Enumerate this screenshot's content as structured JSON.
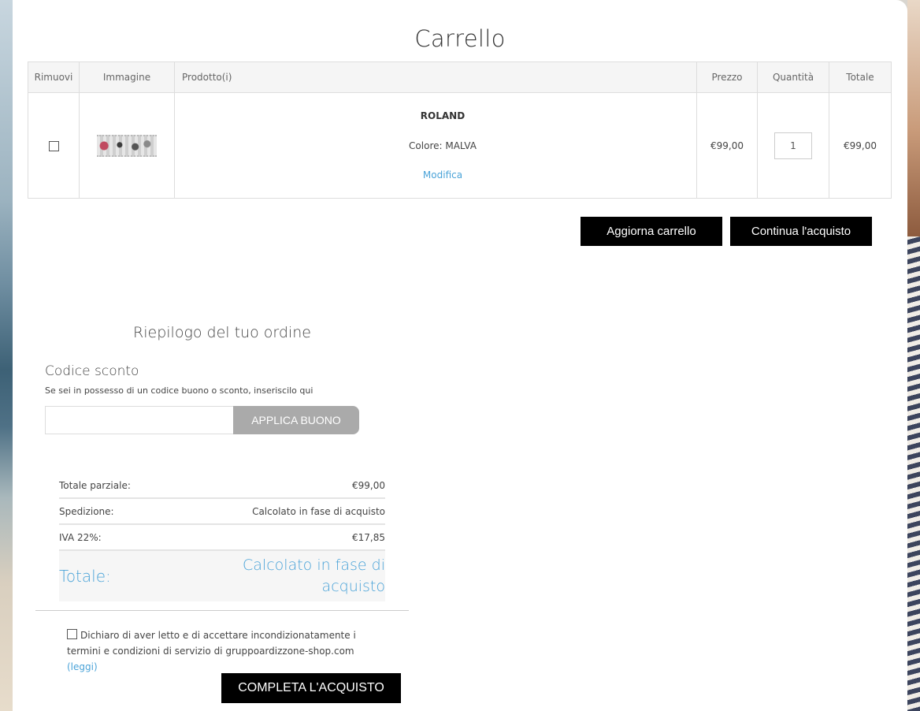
{
  "page": {
    "title": "Carrello"
  },
  "cart": {
    "headers": {
      "remove": "Rimuovi",
      "image": "Immagine",
      "product": "Prodotto(i)",
      "price": "Prezzo",
      "quantity": "Quantità",
      "total": "Totale"
    },
    "item": {
      "name": "ROLAND",
      "color": "Colore: MALVA",
      "edit": "Modifica",
      "price": "€99,00",
      "quantity": "1",
      "total": "€99,00"
    }
  },
  "actions": {
    "update_cart": "Aggiorna carrello",
    "continue_shopping": "Continua l'acquisto"
  },
  "summary": {
    "title": "Riepilogo del tuo ordine",
    "coupon_title": "Codice sconto",
    "coupon_help": "Se sei in possesso di un codice buono o sconto, inseriscilo qui",
    "coupon_placeholder": "",
    "coupon_button": "APPLICA BUONO",
    "subtotal_label": "Totale parziale:",
    "subtotal_value": "€99,00",
    "shipping_label": "Spedizione:",
    "shipping_value": "Calcolato in fase di acquisto",
    "vat_label": "IVA 22%:",
    "vat_value": "€17,85",
    "grand_label": "Totale:",
    "grand_value": "Calcolato in fase di acquisto"
  },
  "terms": {
    "text": "Dichiaro di aver letto e di accettare incondizionatamente i termini e condizioni di servizio di gruppoardizzone-shop.com",
    "link": "(leggi)"
  },
  "checkout": {
    "complete": "COMPLETA L'ACQUISTO"
  },
  "colors": {
    "accent": "#4aa3d8",
    "button": "#000000",
    "coupon_button": "#aaaaaa"
  }
}
